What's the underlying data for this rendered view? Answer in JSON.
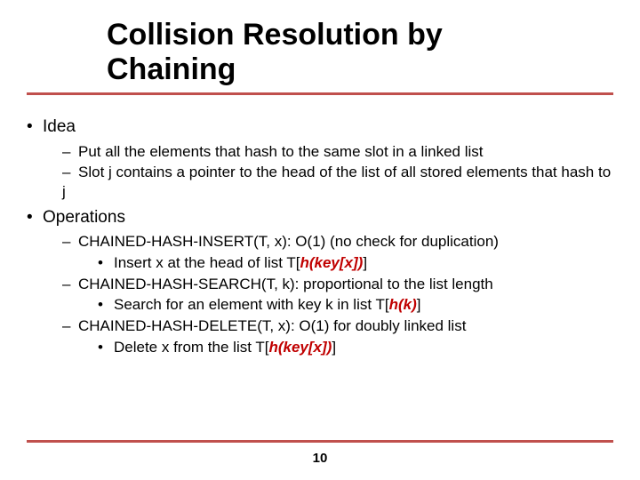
{
  "title_line1": "Collision Resolution by",
  "title_line2": "Chaining",
  "sec1": {
    "heading": "Idea",
    "items": [
      "Put all the elements that hash to the same slot in a linked list",
      "Slot j contains a pointer to the head of the list of all stored elements that hash to j"
    ]
  },
  "sec2": {
    "heading": "Operations",
    "ops": [
      {
        "line_pre": "CHAINED-HASH-INSERT(T, x): O(1) (no check for duplication)",
        "sub_pre": "Insert x at the head of list T[",
        "sub_key": "h(key[x])",
        "sub_post": "]"
      },
      {
        "line_pre": "CHAINED-HASH-SEARCH(T, k): proportional to the list length",
        "sub_pre": "Search for an element with key k in list T[",
        "sub_key": "h(k)",
        "sub_post": "]"
      },
      {
        "line_pre": "CHAINED-HASH-DELETE(T, x): O(1) for doubly linked list",
        "sub_pre": "Delete x from the list T[",
        "sub_key": "h(key[x])",
        "sub_post": "]"
      }
    ]
  },
  "page_number": "10"
}
